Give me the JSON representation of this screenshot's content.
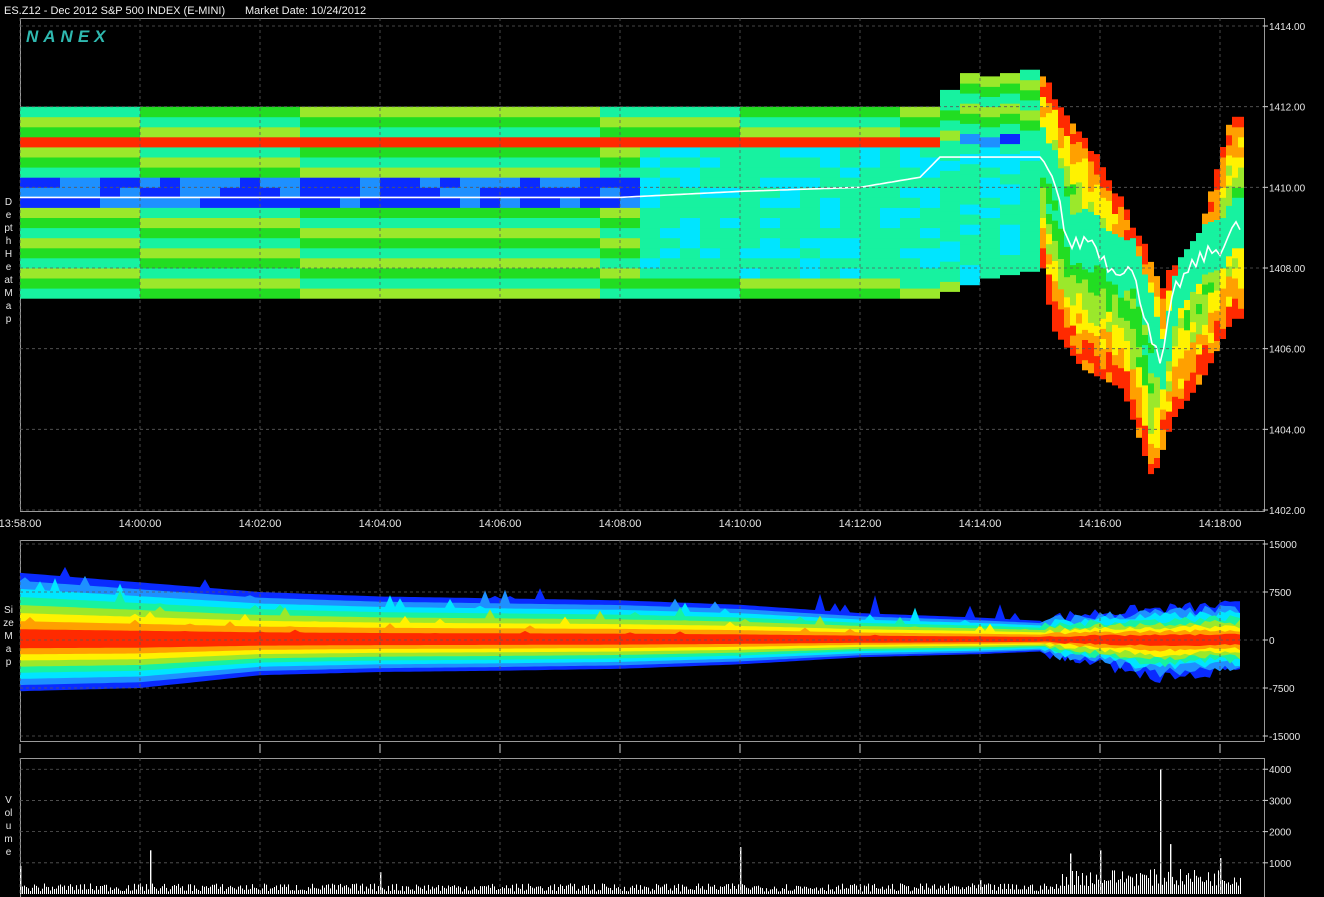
{
  "header": {
    "title": "ES.Z12 - Dec 2012 S&P 500 INDEX (E-MINI)",
    "market_date": "Market Date: 10/24/2012"
  },
  "logo": "NANEX",
  "panels": {
    "heat_label": "Depth Heat Map",
    "size_label": "Size Map",
    "volume_label": "Volume"
  },
  "colors": {
    "background": "#000000",
    "grid": "#5a5a5a",
    "heat_scale": [
      "#0a2bff",
      "#1e90ff",
      "#00e5ff",
      "#17f2a0",
      "#22dd22",
      "#9be82b",
      "#fff200",
      "#ffa000",
      "#ff2a00"
    ],
    "trade_line": "#ffffff",
    "volume_bar": "#ffffff"
  },
  "chart_data": [
    {
      "type": "heatmap",
      "title": "",
      "xlabel": "",
      "ylabel": "",
      "x_ticks": [
        "13:58:00",
        "14:00:00",
        "14:02:00",
        "14:04:00",
        "14:06:00",
        "14:08:00",
        "14:10:00",
        "14:12:00",
        "14:14:00",
        "14:16:00",
        "14:18:00"
      ],
      "y_ticks": [
        "1414.00",
        "1412.00",
        "1410.00",
        "1408.00",
        "1406.00",
        "1404.00",
        "1402.00"
      ],
      "xlim": [
        "13:58:00",
        "14:18:20"
      ],
      "ylim": [
        1402.0,
        1414.0
      ],
      "grid": true,
      "book_top": [
        [
          "13:58:00",
          1412.0
        ],
        [
          "14:13:00",
          1412.0
        ],
        [
          "14:13:40",
          1412.75
        ],
        [
          "14:15:00",
          1412.75
        ],
        [
          "14:15:20",
          1411.75
        ],
        [
          "14:15:40",
          1411.25
        ],
        [
          "14:16:20",
          1409.5
        ],
        [
          "14:17:00",
          1407.5
        ],
        [
          "14:17:40",
          1409.0
        ],
        [
          "14:18:10",
          1411.75
        ]
      ],
      "book_bottom": [
        [
          "13:58:00",
          1407.25
        ],
        [
          "14:13:00",
          1407.25
        ],
        [
          "14:14:00",
          1407.75
        ],
        [
          "14:15:00",
          1408.0
        ],
        [
          "14:15:10",
          1406.5
        ],
        [
          "14:15:40",
          1405.5
        ],
        [
          "14:16:20",
          1405.0
        ],
        [
          "14:16:50",
          1402.75
        ],
        [
          "14:17:10",
          1404.25
        ],
        [
          "14:17:40",
          1405.25
        ],
        [
          "14:18:10",
          1406.75
        ]
      ],
      "bid_offer_line": [
        [
          "13:58:00",
          1409.75
        ],
        [
          "14:00:00",
          1409.75
        ],
        [
          "14:02:00",
          1409.75
        ],
        [
          "14:04:00",
          1409.75
        ],
        [
          "14:06:00",
          1409.75
        ],
        [
          "14:08:00",
          1409.75
        ],
        [
          "14:10:00",
          1409.9
        ],
        [
          "14:12:00",
          1410.0
        ],
        [
          "14:13:00",
          1410.25
        ],
        [
          "14:13:20",
          1410.75
        ],
        [
          "14:15:00",
          1410.75
        ],
        [
          "14:15:15",
          1410.0
        ],
        [
          "14:15:30",
          1408.5
        ],
        [
          "14:15:50",
          1408.75
        ],
        [
          "14:16:10",
          1408.0
        ],
        [
          "14:16:30",
          1408.0
        ],
        [
          "14:16:50",
          1406.5
        ],
        [
          "14:17:00",
          1405.5
        ],
        [
          "14:17:15",
          1407.5
        ],
        [
          "14:17:40",
          1408.25
        ],
        [
          "14:18:00",
          1408.5
        ],
        [
          "14:18:15",
          1409.0
        ]
      ]
    },
    {
      "type": "area",
      "title": "",
      "xlabel": "",
      "ylabel": "",
      "y_ticks": [
        "15000",
        "7500",
        "0",
        "-7500",
        "-15000"
      ],
      "ylim": [
        -15000,
        15000
      ],
      "grid": true,
      "x": [
        "13:58:00",
        "14:00:00",
        "14:02:00",
        "14:04:00",
        "14:06:00",
        "14:08:00",
        "14:10:00",
        "14:12:00",
        "14:14:00",
        "14:15:00",
        "14:16:00",
        "14:17:00",
        "14:18:00"
      ],
      "series": [
        {
          "name": "",
          "values": [
            10500,
            9000,
            7500,
            6800,
            6500,
            6200,
            5500,
            4200,
            3500,
            3000,
            4000,
            4500,
            5000
          ]
        },
        {
          "name": "",
          "values": [
            -8000,
            -7500,
            -5500,
            -5000,
            -4800,
            -4500,
            -3800,
            -2700,
            -2200,
            -1800,
            -3500,
            -5500,
            -4500
          ]
        }
      ]
    },
    {
      "type": "bar",
      "title": "",
      "xlabel": "",
      "ylabel": "",
      "y_ticks": [
        "4000",
        "3000",
        "2000",
        "1000"
      ],
      "ylim": [
        0,
        4200
      ],
      "grid": true,
      "x": [
        "13:58:00",
        "14:00:10",
        "14:04:00",
        "14:10:00",
        "14:14:00",
        "14:15:30",
        "14:16:00",
        "14:17:00",
        "14:17:10",
        "14:18:00"
      ],
      "values": [
        900,
        1400,
        700,
        1500,
        450,
        1300,
        1400,
        4000,
        1600,
        1150
      ]
    }
  ]
}
